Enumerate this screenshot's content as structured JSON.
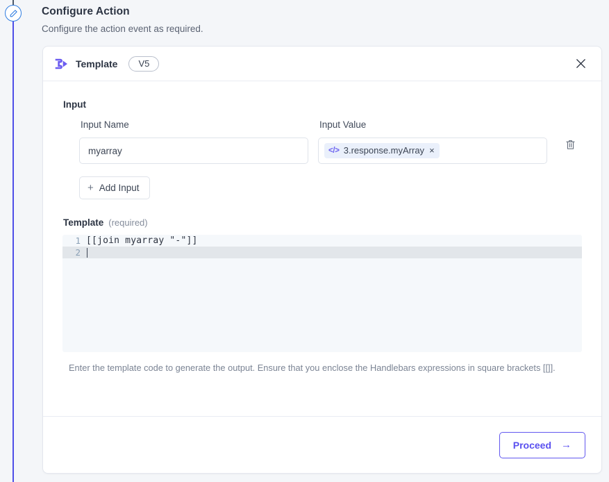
{
  "page": {
    "title": "Configure Action",
    "subtitle": "Configure the action event as required."
  },
  "rail": {
    "node_icon": "pencil-icon"
  },
  "card": {
    "header": {
      "icon": "template-node-icon",
      "title": "Template",
      "version": "V5",
      "close_icon": "close-icon"
    },
    "input_section": {
      "label": "Input",
      "columns": {
        "name_label": "Input Name",
        "value_label": "Input Value"
      },
      "rows": [
        {
          "name_value": "myarray",
          "chip_icon": "code-icon",
          "chip_label": "3.response.myArray",
          "chip_remove": "×",
          "delete_icon": "trash-icon"
        }
      ],
      "add_button": {
        "icon": "plus-icon",
        "label": "Add Input"
      }
    },
    "template_section": {
      "label": "Template",
      "required_hint": "(required)",
      "code_lines": [
        {
          "number": "1",
          "text": "[[join myarray \"-\"]]",
          "active": false
        },
        {
          "number": "2",
          "text": "",
          "active": true
        }
      ],
      "help_text": "Enter the template code to generate the output. Ensure that you enclose the Handlebars expressions in square brackets [[]]."
    },
    "footer": {
      "proceed_label": "Proceed",
      "proceed_arrow": "→"
    }
  },
  "colors": {
    "accent_purple": "#5a50ef",
    "rail_blue": "#4f4ee8",
    "node_ring": "#2f7de1",
    "chip_bg": "#eaf0fb",
    "page_bg": "#f4f6f9"
  }
}
